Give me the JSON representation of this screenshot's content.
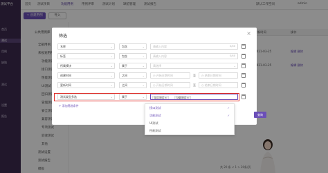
{
  "app": {
    "title": "测试平台"
  },
  "sidebar": {
    "items": [
      {
        "label": "测试平台"
      },
      {
        "label": "首页"
      },
      {
        "label": "测试"
      },
      {
        "label": "用例"
      },
      {
        "label": "缺陷"
      },
      {
        "label": "测试"
      },
      {
        "label": "设置"
      },
      {
        "label": "报告"
      }
    ]
  },
  "topbar": {
    "tabs": [
      {
        "label": "首页"
      },
      {
        "label": "测试项目"
      },
      {
        "label": "功能用例"
      },
      {
        "label": "用例评审"
      },
      {
        "label": "测试计划"
      },
      {
        "label": "缺陷管理"
      },
      {
        "label": "测试报告"
      }
    ],
    "right_text": "默认工作空间",
    "user": "admin"
  },
  "toolbar": {
    "new_label": "+ 创建用例",
    "import_label": "导入"
  },
  "tree": {
    "nodes": [
      {
        "label": "公共用例库"
      },
      {
        "label": "全部用例"
      },
      {
        "label": "未规划用例"
      },
      {
        "label": "功能测试"
      },
      {
        "label": "接口测试"
      },
      {
        "label": "性能测试"
      },
      {
        "label": "UI测试"
      },
      {
        "label": "回归测试"
      },
      {
        "label": "冒烟测试"
      },
      {
        "label": "安全测试"
      },
      {
        "label": "兼容测试"
      },
      {
        "label": "专项测试"
      },
      {
        "label": "验收测试"
      },
      {
        "label": "其他"
      },
      {
        "label": "测试设置"
      },
      {
        "label": "测试报告"
      },
      {
        "label": "模板"
      }
    ]
  },
  "table": {
    "header": [
      "更新时间",
      "操作"
    ],
    "rows": [
      {
        "date": "2021-03-25",
        "ops": "编辑 删除"
      },
      {
        "date": "2021-03-25",
        "ops": "编辑 删除"
      }
    ]
  },
  "modal": {
    "title": "筛选",
    "rows": [
      {
        "field": "名称",
        "op": "包含",
        "placeholder": "请输入内容",
        "counter": "0/40"
      },
      {
        "field": "标签",
        "op": "包含",
        "placeholder": "请输入内容",
        "counter": "0/40"
      },
      {
        "field": "所属模块",
        "op": "属于",
        "placeholder": "请选择"
      },
      {
        "field": "创建时间",
        "op": "之间",
        "start_placeholder": "开始日期时间",
        "sep": "至",
        "end_placeholder": "结束日期时间"
      },
      {
        "field": "更新时间",
        "op": "之间",
        "start_placeholder": "开始日期时间",
        "sep": "至",
        "end_placeholder": "结束日期时间"
      },
      {
        "field": "测试类型多选",
        "op": "属于",
        "tags": [
          "接口测试",
          "功能测试"
        ]
      }
    ],
    "add_condition": "+ 添加筛选条件",
    "search_label": "查询"
  },
  "dropdown": {
    "options": [
      {
        "label": "接口测试",
        "selected": true
      },
      {
        "label": "功能测试",
        "selected": true
      },
      {
        "label": "UI测试",
        "selected": false
      },
      {
        "label": "性能测试",
        "selected": false
      }
    ]
  },
  "pager": {
    "text": "共 20 条  < 1 >  20条/页"
  },
  "colors": {
    "accent": "#6b4fb8",
    "sidebar": "#3c2b4f",
    "highlight": "#e0302a"
  }
}
